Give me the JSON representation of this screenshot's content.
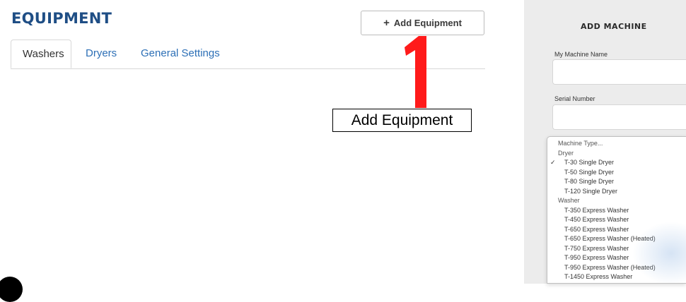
{
  "page": {
    "title": "EQUIPMENT"
  },
  "tabs": [
    {
      "label": "Washers",
      "active": true
    },
    {
      "label": "Dryers",
      "active": false
    },
    {
      "label": "General Settings",
      "active": false
    }
  ],
  "add_button": {
    "icon": "+",
    "label": "Add Equipment"
  },
  "annotation": {
    "step_number": "1",
    "callout_label": "Add Equipment",
    "step_color": "#ff1a1a"
  },
  "panel": {
    "title": "ADD MACHINE",
    "machine_name_label": "My Machine Name",
    "serial_number_label": "Serial Number"
  },
  "machine_type": {
    "placeholder": "Machine Type...",
    "groups": [
      {
        "label": "Dryer",
        "options": [
          "T-30 Single Dryer",
          "T-50 Single Dryer",
          "T-80 Single Dryer",
          "T-120 Single Dryer"
        ]
      },
      {
        "label": "Washer",
        "options": [
          "T-350 Express Washer",
          "T-450 Express Washer",
          "T-650 Express Washer",
          "T-650 Express Washer (Heated)",
          "T-750 Express Washer",
          "T-950 Express Washer",
          "T-950 Express Washer (Heated)",
          "T-1450 Express Washer"
        ]
      }
    ],
    "selected": "T-30 Single Dryer",
    "check_glyph": "✓"
  },
  "colors": {
    "brand_blue": "#1f4e85",
    "link_blue": "#2c6fb6",
    "panel_bg": "#ececec"
  }
}
